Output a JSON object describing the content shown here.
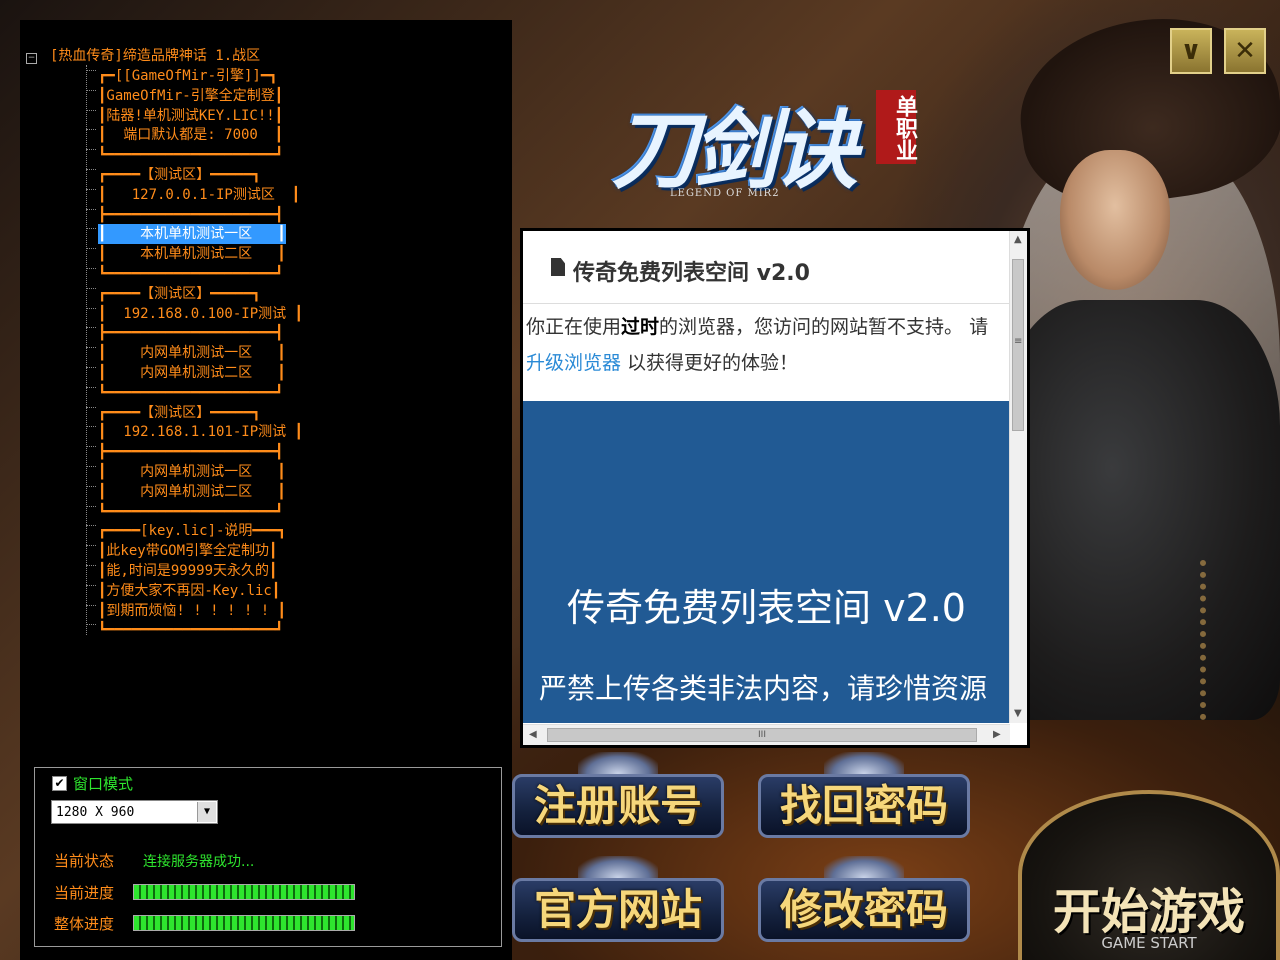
{
  "tree": {
    "root": "[热血传奇]缔造品牌神话 1.战区",
    "rows": [
      "┏━[[GameOfMir-引擎]]━┓",
      "┃GameOfMir-引擎全定制登┃",
      "┃陆器!单机测试KEY.LIC!!┃",
      "┃  端口默认都是: 7000  ┃",
      "┗━━━━━━━━━━━━━━━━━━━━┛",
      "┏━━━━【测试区】━━━━━┓",
      "┃   127.0.0.1-IP测试区  ┃",
      "┣━━━━━━━━━━━━━━━━━━━━┫",
      "┃    本机单机测试一区   ┃",
      "┃    本机单机测试二区   ┃",
      "┗━━━━━━━━━━━━━━━━━━━━┛",
      "┏━━━━【测试区】━━━━━┓",
      "┃  192.168.0.100-IP测试 ┃",
      "┣━━━━━━━━━━━━━━━━━━━━┫",
      "┃    内网单机测试一区   ┃",
      "┃    内网单机测试二区   ┃",
      "┗━━━━━━━━━━━━━━━━━━━━┛",
      "┏━━━━【测试区】━━━━━┓",
      "┃  192.168.1.101-IP测试 ┃",
      "┣━━━━━━━━━━━━━━━━━━━━┫",
      "┃    内网单机测试一区   ┃",
      "┃    内网单机测试二区   ┃",
      "┗━━━━━━━━━━━━━━━━━━━━┛",
      "┏━━━━[key.lic]-说明━━━┓",
      "┃此key带GOM引擎全定制功┃",
      "┃能,时间是99999天永久的┃",
      "┃方便大家不再因-Key.lic┃",
      "┃到期而烦恼! ! ! ! ! ! ┃",
      "┗━━━━━━━━━━━━━━━━━━━━┛"
    ],
    "selected_index": 8
  },
  "options": {
    "window_mode_label": "窗口模式",
    "window_mode_checked": true,
    "resolution": "1280 X 960",
    "status_label": "当前状态",
    "status_value": "连接服务器成功...",
    "progress_label": "当前进度",
    "progress_value": 1.0,
    "total_label": "整体进度",
    "total_value": 1.0
  },
  "browser": {
    "title": "传奇免费列表空间 v2.0",
    "msg_pre": "你正在使用",
    "msg_bold": "过时",
    "msg_mid": "的浏览器，您访问的网站暂不支持。 请",
    "msg_link": "升级浏览器",
    "msg_post": " 以获得更好的体验！",
    "hero_title": "传奇免费列表空间 v2.0",
    "hero_sub": "严禁上传各类非法内容，请珍惜资源",
    "hthumb_grip": "III",
    "vthumb_grip": "≡"
  },
  "logo": {
    "main": "刀剑诀",
    "seal": "单职业",
    "sub": "LEGEND OF MIR2"
  },
  "window_buttons": {
    "minimize": "∨",
    "close": "✕"
  },
  "buttons": {
    "register": "注册账号",
    "recover": "找回密码",
    "website": "官方网站",
    "change_password": "修改密码",
    "start_cn": "开始游戏",
    "start_en": "GAME START"
  },
  "colors": {
    "tree_text": "#ff8c1a",
    "status_green": "#2ee52e",
    "selection": "#3399ff",
    "browser_hero": "#215a94",
    "button_text": "#f6d77b"
  }
}
